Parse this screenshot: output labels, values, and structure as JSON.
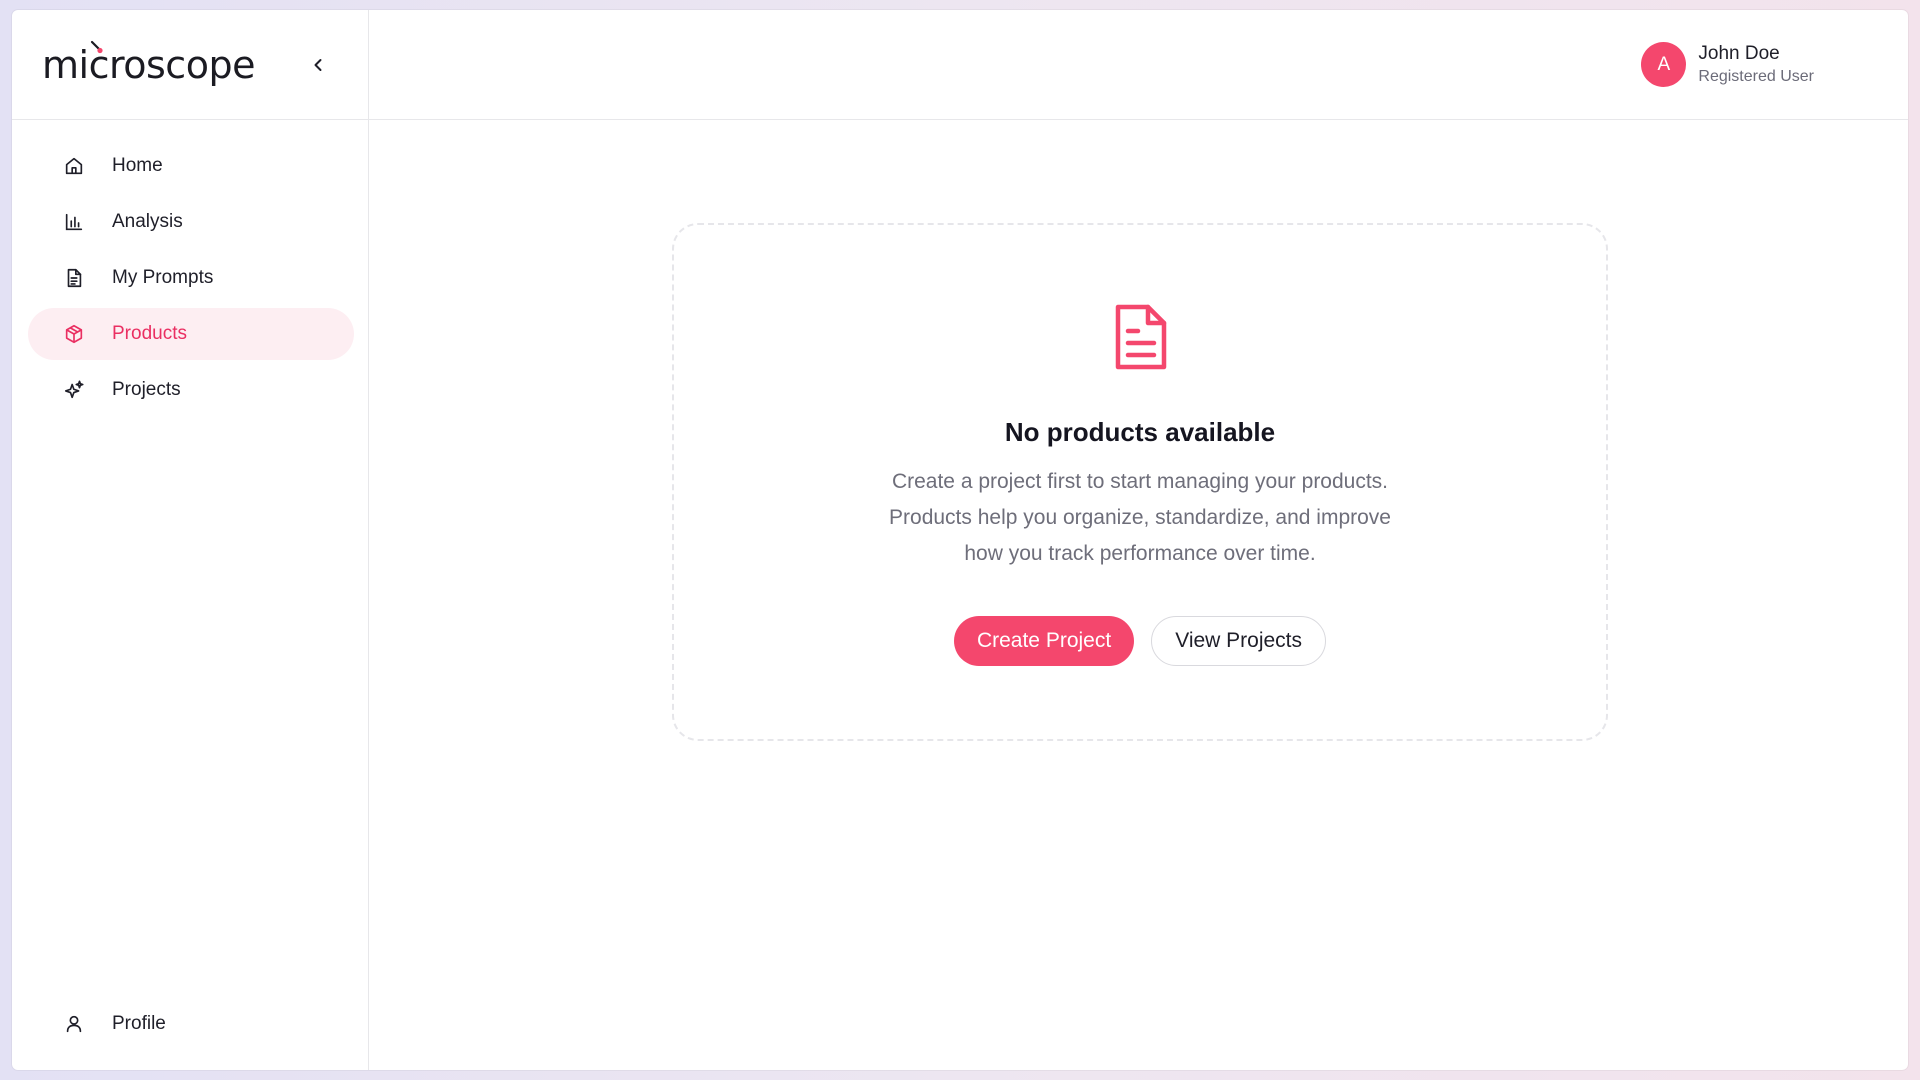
{
  "app": {
    "logo_text": "microscope"
  },
  "colors": {
    "accent": "#f4476d",
    "active_bg": "#fdeef2",
    "active_text": "#ea2f62"
  },
  "sidebar": {
    "items": [
      {
        "label": "Home",
        "icon": "home-icon"
      },
      {
        "label": "Analysis",
        "icon": "bar-chart-icon"
      },
      {
        "label": "My Prompts",
        "icon": "document-icon"
      },
      {
        "label": "Products",
        "icon": "box-icon",
        "active": true
      },
      {
        "label": "Projects",
        "icon": "sparkles-icon"
      }
    ],
    "footer": {
      "label": "Profile",
      "icon": "user-icon"
    }
  },
  "user": {
    "avatar_initial": "A",
    "name": "John Doe",
    "role": "Registered User"
  },
  "empty_state": {
    "icon": "document-icon",
    "title": "No products available",
    "desc_line1": "Create a project first to start managing your products.",
    "desc_line2": "Products help you organize, standardize, and improve",
    "desc_line3": "how you track performance over time.",
    "primary_button": "Create Project",
    "secondary_button": "View Projects"
  }
}
